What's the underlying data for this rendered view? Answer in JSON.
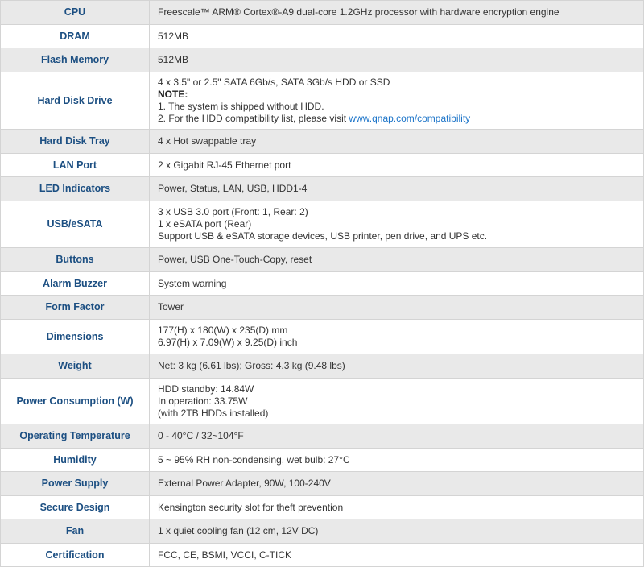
{
  "specs": [
    {
      "label": "CPU",
      "lines": [
        "Freescale™ ARM® Cortex®-A9 dual-core 1.2GHz processor with hardware encryption engine"
      ]
    },
    {
      "label": "DRAM",
      "lines": [
        "512MB"
      ]
    },
    {
      "label": "Flash Memory",
      "lines": [
        "512MB"
      ]
    },
    {
      "label": "Hard Disk Drive",
      "lines": [
        "4 x 3.5\" or 2.5\" SATA 6Gb/s, SATA 3Gb/s HDD or SSD",
        "NOTE:",
        "1. The system is shipped without HDD.",
        "2. For the HDD compatibility list, please visit "
      ],
      "link": "www.qnap.com/compatibility"
    },
    {
      "label": "Hard Disk Tray",
      "lines": [
        "4 x Hot swappable tray"
      ]
    },
    {
      "label": "LAN Port",
      "lines": [
        "2 x Gigabit RJ-45 Ethernet port"
      ]
    },
    {
      "label": "LED Indicators",
      "lines": [
        "Power, Status, LAN, USB, HDD1-4"
      ]
    },
    {
      "label": "USB/eSATA",
      "lines": [
        "3 x USB 3.0 port (Front: 1, Rear: 2)",
        "1 x eSATA port (Rear)",
        "Support USB & eSATA storage devices, USB printer, pen drive, and UPS etc."
      ]
    },
    {
      "label": "Buttons",
      "lines": [
        "Power, USB One-Touch-Copy, reset"
      ]
    },
    {
      "label": "Alarm Buzzer",
      "lines": [
        "System warning"
      ]
    },
    {
      "label": "Form Factor",
      "lines": [
        "Tower"
      ]
    },
    {
      "label": "Dimensions",
      "lines": [
        "177(H) x 180(W) x 235(D) mm",
        "6.97(H) x 7.09(W) x 9.25(D) inch"
      ]
    },
    {
      "label": "Weight",
      "lines": [
        "Net: 3 kg (6.61 lbs); Gross: 4.3 kg (9.48 lbs)"
      ]
    },
    {
      "label": "Power Consumption (W)",
      "lines": [
        "HDD standby: 14.84W",
        "In operation: 33.75W",
        "(with 2TB HDDs installed)"
      ]
    },
    {
      "label": "Operating Temperature",
      "lines": [
        "0 - 40°C / 32~104°F"
      ]
    },
    {
      "label": "Humidity",
      "lines": [
        "5 ~ 95% RH non-condensing, wet bulb: 27°C"
      ]
    },
    {
      "label": "Power Supply",
      "lines": [
        "External Power Adapter, 90W, 100-240V"
      ]
    },
    {
      "label": "Secure Design",
      "lines": [
        "Kensington security slot for theft prevention"
      ]
    },
    {
      "label": "Fan",
      "lines": [
        "1 x quiet cooling fan (12 cm, 12V DC)"
      ]
    },
    {
      "label": "Certification",
      "lines": [
        "FCC, CE, BSMI, VCCI, C-TICK"
      ]
    }
  ]
}
